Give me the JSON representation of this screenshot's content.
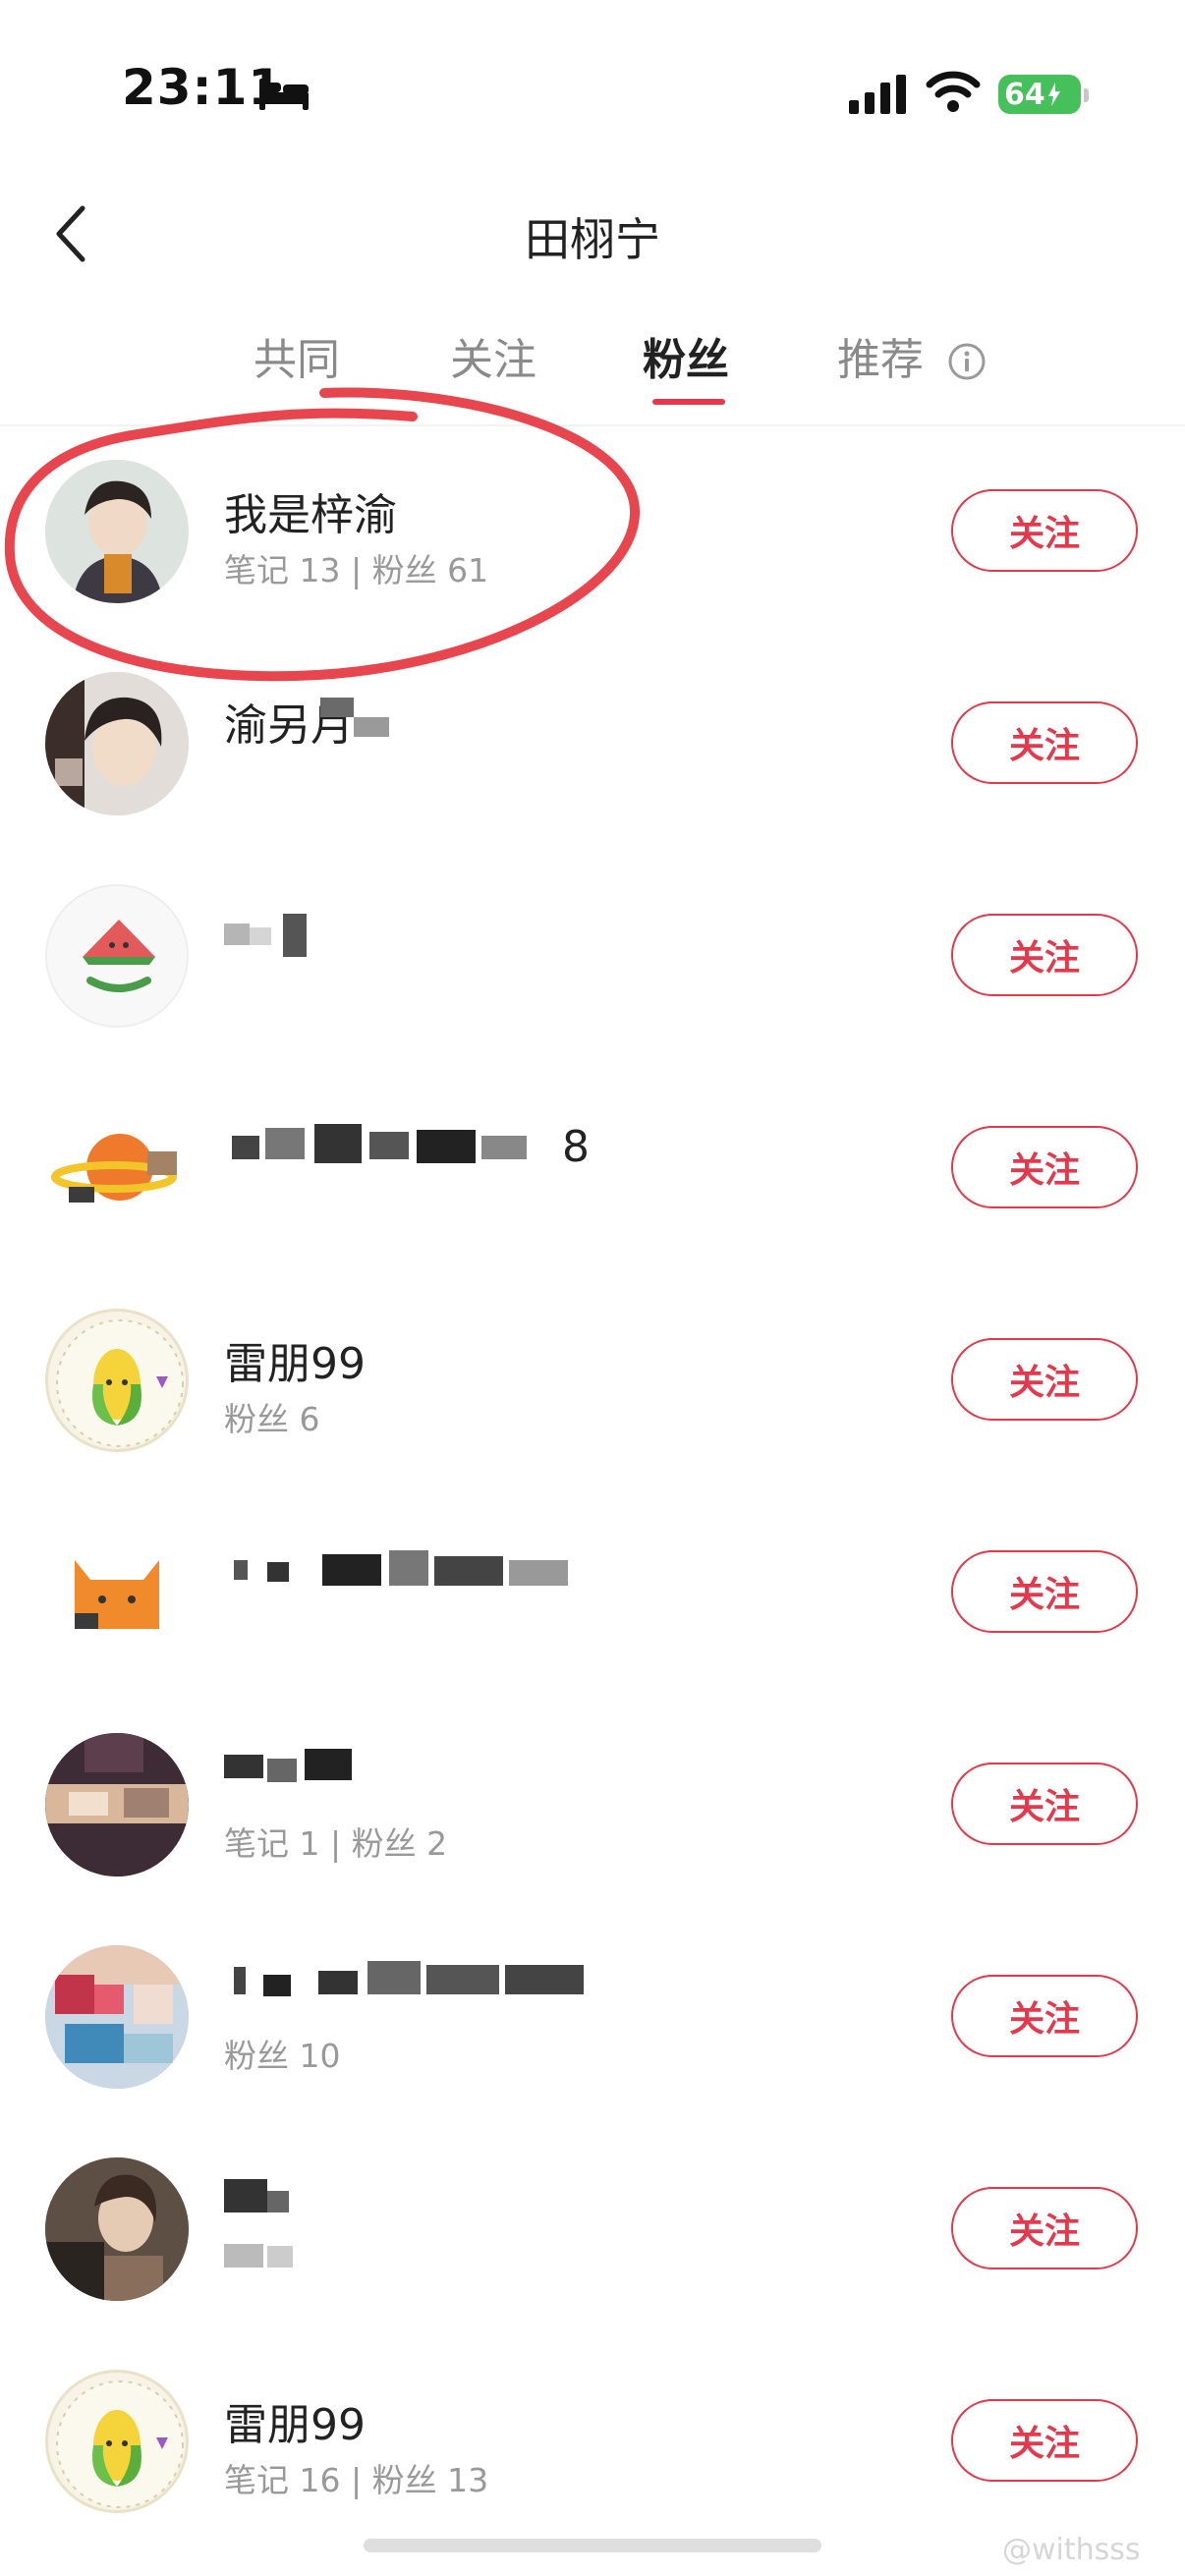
{
  "status_bar": {
    "time": "23:11",
    "battery": "64",
    "icons": [
      "bed-icon",
      "signal-icon",
      "wifi-icon",
      "battery-charging-icon"
    ],
    "battery_color": "#46c05a"
  },
  "header": {
    "title": "田栩宁",
    "back_icon": "chevron-left-icon"
  },
  "tabs": [
    {
      "label": "共同",
      "active": false
    },
    {
      "label": "关注",
      "active": false
    },
    {
      "label": "粉丝",
      "active": true
    },
    {
      "label": "推荐",
      "active": false
    }
  ],
  "accent_color": "#e4394c",
  "users": [
    {
      "name": "我是梓渝",
      "meta": "笔记 13 | 粉丝 61",
      "button": "关注",
      "avatar": "photo-avatar"
    },
    {
      "name": "渝另月",
      "meta": "",
      "button": "关注",
      "avatar": "photo-avatar"
    },
    {
      "name": "",
      "meta": "",
      "button": "关注",
      "avatar": "watermelon-avatar"
    },
    {
      "name": "8",
      "meta": "",
      "button": "关注",
      "avatar": "planet-avatar"
    },
    {
      "name": "雷朋99",
      "meta": "粉丝 6",
      "button": "关注",
      "avatar": "corn-avatar"
    },
    {
      "name": "",
      "meta": "",
      "button": "关注",
      "avatar": "cat-avatar"
    },
    {
      "name": "",
      "meta": "笔记 1 | 粉丝 2",
      "button": "关注",
      "avatar": "photo-avatar"
    },
    {
      "name": "",
      "meta": "粉丝 10",
      "button": "关注",
      "avatar": "photo-avatar"
    },
    {
      "name": "",
      "meta": "",
      "button": "关注",
      "avatar": "photo-avatar"
    },
    {
      "name": "雷朋99",
      "meta": "笔记 16 | 粉丝 13",
      "button": "关注",
      "avatar": "corn-avatar"
    }
  ],
  "watermark": "@withsss"
}
